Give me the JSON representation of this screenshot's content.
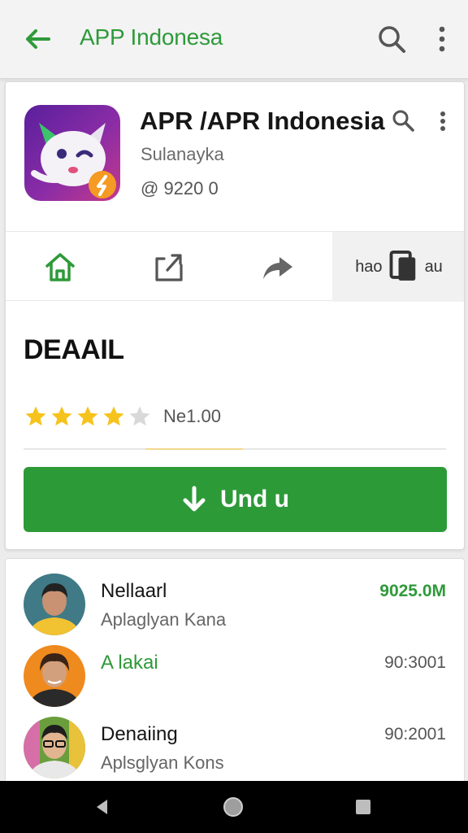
{
  "appbar": {
    "title": "APP Indonesa"
  },
  "app": {
    "name": "APR /APR Indonesia",
    "developer": "Sulanayka",
    "meta": "@ 9220 0"
  },
  "tabs": [
    {
      "icon": "home-icon"
    },
    {
      "icon": "share-icon"
    },
    {
      "icon": "forward-icon"
    },
    {
      "label_left": "hao",
      "label_right": "au",
      "icon": "document-icon"
    }
  ],
  "section": {
    "title": "DEAAIL"
  },
  "rating": {
    "stars": 4,
    "max": 5,
    "text": "Ne1.00"
  },
  "install": {
    "label": "Und u"
  },
  "list": [
    {
      "name": "Nellaarl",
      "sub": "Aplaglyan Kana",
      "time": "9025.0M",
      "highlight_time": true,
      "highlight_name": false
    },
    {
      "name": "A lakai",
      "sub": "",
      "time": "90:3001",
      "highlight_time": false,
      "highlight_name": true
    },
    {
      "name": "Denaiing",
      "sub": "Aplsglyan Kons",
      "time": "90:2001",
      "highlight_time": false,
      "highlight_name": false
    }
  ],
  "colors": {
    "accent": "#2d9a38",
    "star": "#f6c31c",
    "star_empty": "#d9d9d9"
  }
}
